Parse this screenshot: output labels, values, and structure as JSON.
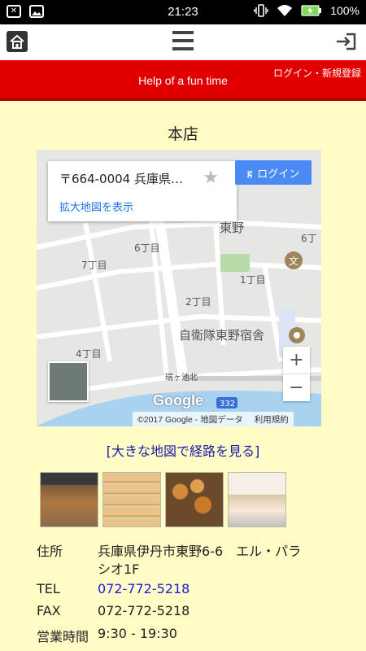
{
  "status_bar": {
    "time": "21:23",
    "battery_percent": "100%"
  },
  "header": {
    "tagline": "Help of a fun time",
    "auth_link": "ログイン・新規登録"
  },
  "store": {
    "title": "本店",
    "map": {
      "address_card": "〒664-0004 兵庫県…",
      "expand_link": "拡大地図を表示",
      "google_login": "ログイン",
      "zoom_in": "+",
      "zoom_out": "−",
      "logo": "Google",
      "copyright": "©2017 Google - 地図データ",
      "terms": "利用規約",
      "labels": [
        "東野",
        "6丁目",
        "7丁目",
        "6丁",
        "1丁目",
        "2丁目",
        "自衛隊東野宿舎",
        "4丁目",
        "瑞ヶ池北",
        "332"
      ]
    },
    "big_map_link": "[大きな地図で経路を見る]",
    "info": {
      "address_label": "住所",
      "address_line1": "兵庫県伊丹市東野6-6　エル・パラ",
      "address_line2": "シオ1F",
      "tel_label": "TEL",
      "tel": "072-772-5218",
      "fax_label": "FAX",
      "fax": "072-772-5218",
      "hours_label": "営業時間",
      "hours": "9:30 - 19:30"
    }
  },
  "colors": {
    "header_red": "#e00000",
    "page_bg": "#fffcc6",
    "link_blue": "#1a1ae0"
  }
}
